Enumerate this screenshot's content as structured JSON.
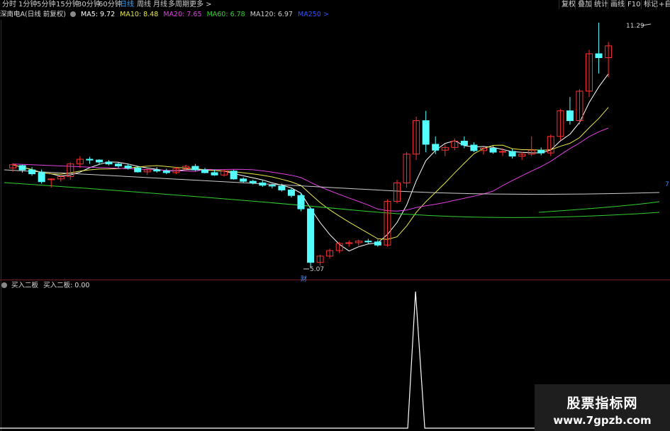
{
  "periods": [
    "分时",
    "1分钟",
    "5分钟",
    "15分钟",
    "30分钟",
    "60分钟",
    "日线",
    "周线",
    "月线",
    "多周期",
    "更多 >"
  ],
  "active_period": "日线",
  "toolbar": [
    "复权",
    "叠加",
    "统计",
    "画线",
    "F10",
    "标记",
    "+自选"
  ],
  "ma_row": {
    "stock": "深南电A(日线 前复权)",
    "ma5": "MA5: 9.72",
    "ma10": "MA10: 8.48",
    "ma20": "MA20: 7.65",
    "ma60": "MA60: 6.78",
    "ma120": "MA120: 6.97",
    "ma250": "MA250 >"
  },
  "ma_colors": {
    "ma5": "#ffffff",
    "ma10": "#e8e84a",
    "ma20": "#e040e0",
    "ma60": "#30d030",
    "ma120": "#cccccc",
    "ma250": "#3050ff"
  },
  "price_high_label": "11.29",
  "price_low_label": "5.07",
  "cai_label": "财",
  "right_edge_label": "7",
  "indicator_row": {
    "name": "买入二板",
    "value": "买入二板: 0.00"
  },
  "watermark": {
    "line1": "股票指标网",
    "line2": "www.7gpzb.com"
  },
  "colors": {
    "up": "#ff3030",
    "down": "#54ffff",
    "bg": "#000000"
  },
  "candles": [
    [
      7.6,
      7.72,
      7.5,
      7.68
    ],
    [
      7.66,
      7.68,
      7.48,
      7.55
    ],
    [
      7.55,
      7.62,
      7.4,
      7.45
    ],
    [
      7.48,
      7.56,
      7.2,
      7.25
    ],
    [
      7.3,
      7.34,
      7.1,
      7.32
    ],
    [
      7.32,
      7.42,
      7.25,
      7.38
    ],
    [
      7.38,
      7.74,
      7.3,
      7.7
    ],
    [
      7.7,
      7.9,
      7.6,
      7.82
    ],
    [
      7.82,
      7.88,
      7.7,
      7.8
    ],
    [
      7.8,
      7.82,
      7.68,
      7.75
    ],
    [
      7.75,
      7.8,
      7.66,
      7.7
    ],
    [
      7.7,
      7.74,
      7.6,
      7.65
    ],
    [
      7.65,
      7.7,
      7.56,
      7.6
    ],
    [
      7.6,
      7.64,
      7.48,
      7.5
    ],
    [
      7.5,
      7.58,
      7.42,
      7.55
    ],
    [
      7.55,
      7.62,
      7.48,
      7.52
    ],
    [
      7.52,
      7.58,
      7.44,
      7.48
    ],
    [
      7.48,
      7.62,
      7.44,
      7.58
    ],
    [
      7.58,
      7.68,
      7.52,
      7.64
    ],
    [
      7.64,
      7.7,
      7.52,
      7.55
    ],
    [
      7.55,
      7.6,
      7.46,
      7.48
    ],
    [
      7.48,
      7.56,
      7.4,
      7.42
    ],
    [
      7.42,
      7.56,
      7.38,
      7.52
    ],
    [
      7.52,
      7.55,
      7.3,
      7.32
    ],
    [
      7.32,
      7.36,
      7.22,
      7.26
    ],
    [
      7.26,
      7.3,
      7.18,
      7.22
    ],
    [
      7.22,
      7.28,
      7.12,
      7.16
    ],
    [
      7.16,
      7.2,
      7.08,
      7.14
    ],
    [
      7.14,
      7.2,
      7.0,
      7.04
    ],
    [
      7.04,
      7.08,
      6.85,
      6.9
    ],
    [
      6.9,
      6.95,
      6.5,
      6.56
    ],
    [
      6.56,
      6.6,
      5.07,
      5.2
    ],
    [
      5.2,
      5.4,
      5.12,
      5.36
    ],
    [
      5.36,
      5.55,
      5.3,
      5.5
    ],
    [
      5.5,
      5.72,
      5.44,
      5.68
    ],
    [
      5.68,
      5.76,
      5.6,
      5.7
    ],
    [
      5.7,
      5.78,
      5.62,
      5.74
    ],
    [
      5.74,
      5.8,
      5.66,
      5.72
    ],
    [
      5.72,
      5.78,
      5.6,
      5.64
    ],
    [
      5.64,
      6.8,
      5.6,
      6.75
    ],
    [
      6.75,
      7.3,
      6.7,
      7.22
    ],
    [
      7.22,
      8.0,
      7.1,
      7.95
    ],
    [
      7.95,
      8.9,
      7.8,
      8.8
    ],
    [
      8.8,
      9.05,
      8.0,
      8.2
    ],
    [
      8.2,
      8.4,
      7.95,
      8.05
    ],
    [
      8.05,
      8.2,
      7.9,
      8.12
    ],
    [
      8.12,
      8.35,
      8.05,
      8.28
    ],
    [
      8.28,
      8.4,
      8.1,
      8.18
    ],
    [
      8.18,
      8.25,
      8.0,
      8.04
    ],
    [
      8.04,
      8.12,
      7.94,
      8.1
    ],
    [
      8.1,
      8.16,
      7.96,
      8.0
    ],
    [
      8.0,
      8.1,
      7.9,
      8.02
    ],
    [
      8.02,
      8.08,
      7.84,
      7.9
    ],
    [
      7.9,
      8.0,
      7.8,
      7.95
    ],
    [
      7.95,
      8.4,
      7.9,
      8.05
    ],
    [
      8.05,
      8.12,
      7.92,
      7.98
    ],
    [
      7.98,
      8.45,
      7.9,
      8.4
    ],
    [
      8.4,
      9.1,
      8.3,
      9.05
    ],
    [
      9.05,
      9.4,
      8.7,
      8.8
    ],
    [
      8.8,
      9.6,
      8.7,
      9.55
    ],
    [
      9.55,
      10.6,
      9.4,
      10.5
    ],
    [
      10.5,
      11.29,
      10.0,
      10.4
    ],
    [
      10.4,
      10.8,
      9.9,
      10.7
    ]
  ],
  "indicator_series": [
    0,
    0,
    0,
    0,
    0,
    0,
    0,
    0,
    0,
    0,
    0,
    0,
    0,
    0,
    0,
    0,
    0,
    0,
    0,
    0,
    0,
    0,
    0,
    0,
    0,
    0,
    0,
    0,
    0,
    0,
    0,
    0,
    0,
    0,
    0,
    0,
    0,
    0,
    0,
    0,
    0,
    0,
    1,
    0,
    0,
    0,
    0,
    0,
    0,
    0,
    0,
    0,
    0,
    0,
    0,
    0,
    0,
    0,
    0,
    0,
    0,
    0,
    0
  ]
}
